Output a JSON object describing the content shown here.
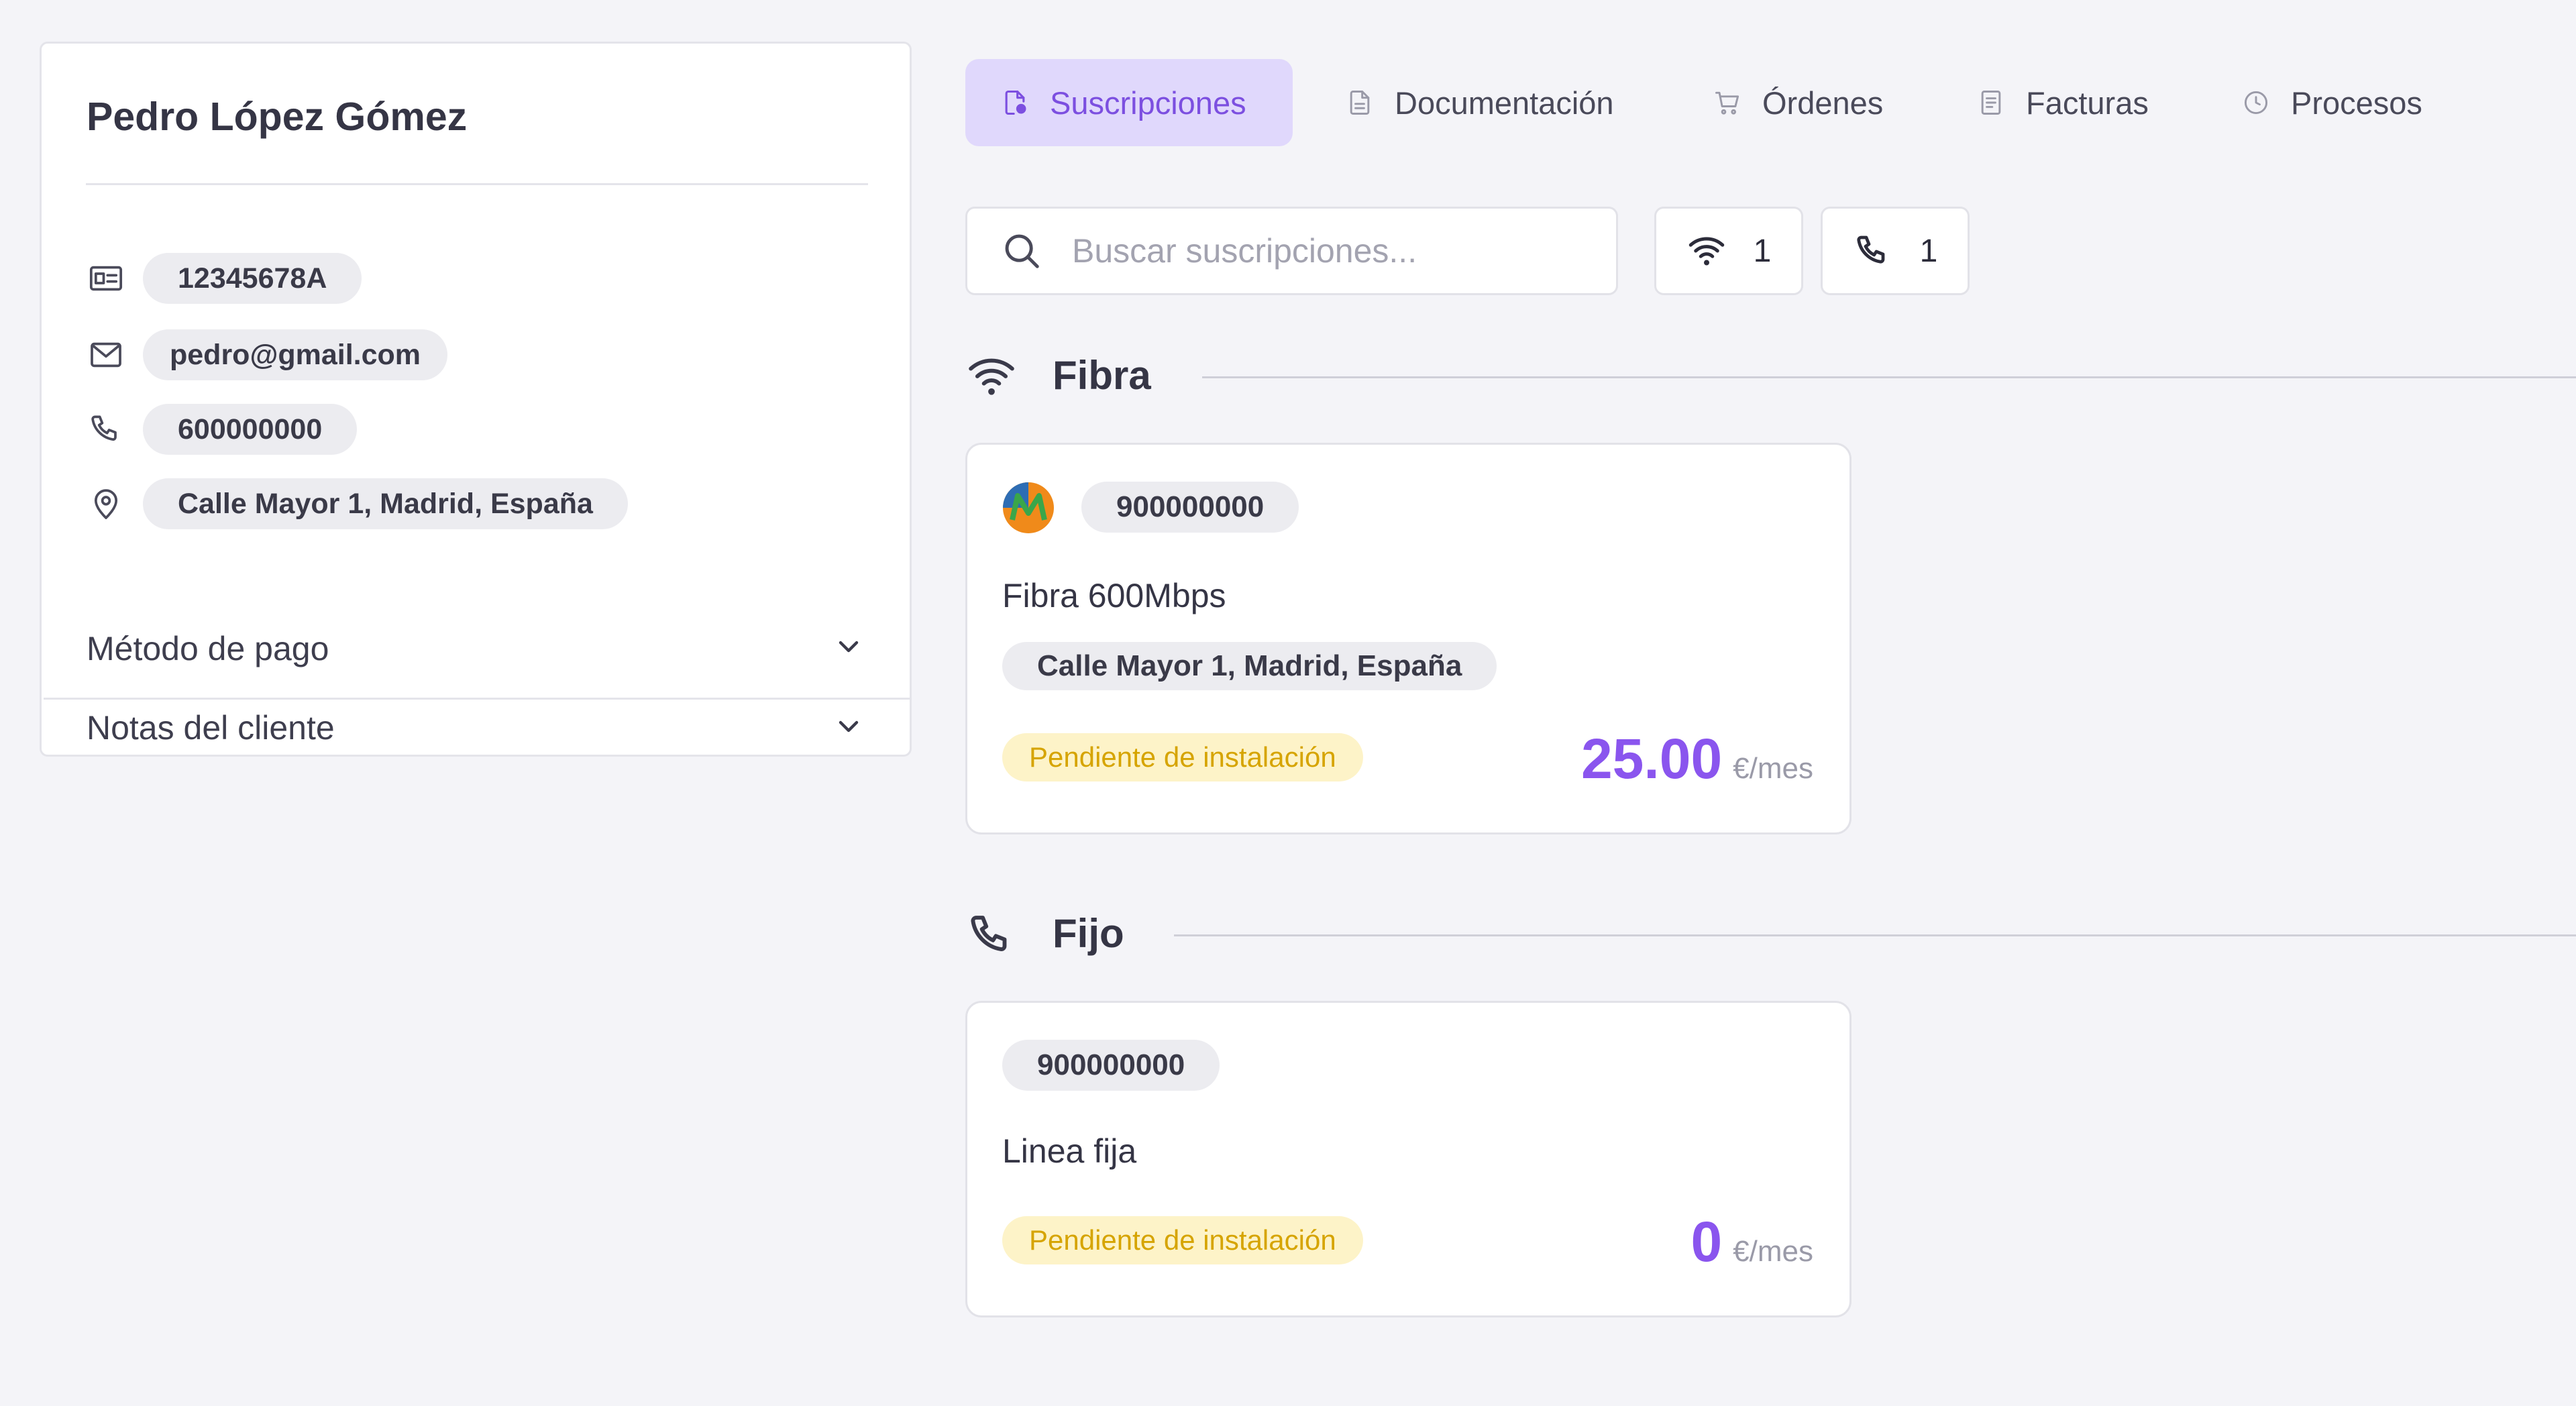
{
  "customer": {
    "name": "Pedro López Gómez",
    "dni": "12345678A",
    "email": "pedro@gmail.com",
    "phone": "600000000",
    "address": "Calle Mayor 1, Madrid, España",
    "accordions": [
      "Método de pago",
      "Notas del cliente"
    ]
  },
  "tabs": [
    {
      "label": "Suscripciones",
      "icon": "file-badge-icon",
      "active": true
    },
    {
      "label": "Documentación",
      "icon": "document-icon",
      "active": false
    },
    {
      "label": "Órdenes",
      "icon": "cart-icon",
      "active": false
    },
    {
      "label": "Facturas",
      "icon": "invoice-icon",
      "active": false
    },
    {
      "label": "Procesos",
      "icon": "clock-icon",
      "active": false
    }
  ],
  "search": {
    "placeholder": "Buscar suscripciones...",
    "value": ""
  },
  "filters": [
    {
      "icon": "wifi-icon",
      "count": "1"
    },
    {
      "icon": "phone-icon",
      "count": "1"
    }
  ],
  "sections": [
    {
      "title": "Fibra",
      "icon": "wifi-icon",
      "card": {
        "number": "900000000",
        "plan": "Fibra 600Mbps",
        "address": "Calle Mayor 1, Madrid, España",
        "status": "Pendiente de instalación",
        "price": "25.00",
        "unit": "€/mes"
      }
    },
    {
      "title": "Fijo",
      "icon": "phone-icon",
      "card": {
        "number": "900000000",
        "plan": "Linea fija",
        "status": "Pendiente de instalación",
        "price": "0",
        "unit": "€/mes"
      }
    }
  ],
  "colors": {
    "accent": "#8a55ee",
    "tab_active_bg": "#e0d8fc",
    "status_bg": "#fdf3c8",
    "status_text": "#d6a400",
    "background": "#f4f4f8"
  }
}
